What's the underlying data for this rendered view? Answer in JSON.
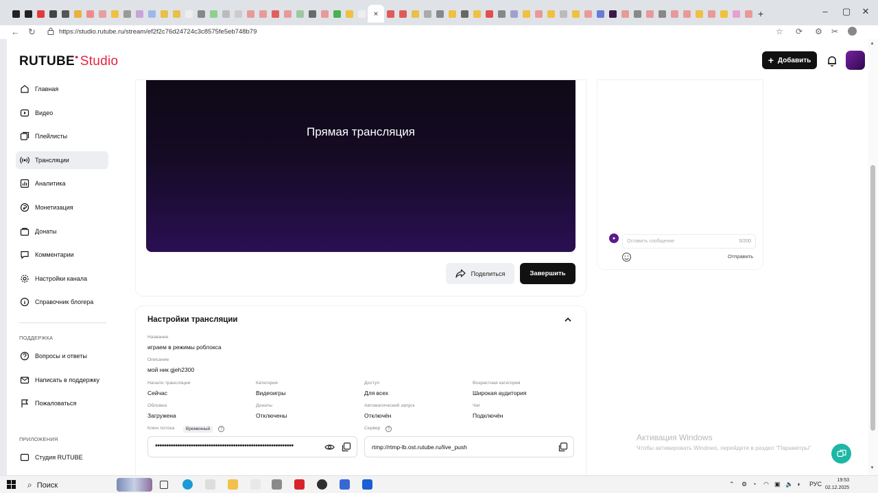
{
  "browser": {
    "url": "https://studio.rutube.ru/stream/ef2f2c76d24724c3c8575fe5eb748b79",
    "close_tab": "×",
    "new_tab": "+"
  },
  "header": {
    "logo_main": "RUTUBE",
    "logo_studio": "Studio",
    "add_button": "Добавить",
    "add_icon": "+"
  },
  "sidebar": {
    "items": [
      {
        "label": "Главная",
        "icon": "home-icon"
      },
      {
        "label": "Видео",
        "icon": "video-icon"
      },
      {
        "label": "Плейлисты",
        "icon": "playlist-icon"
      },
      {
        "label": "Трансляции",
        "icon": "broadcast-icon",
        "active": true
      },
      {
        "label": "Аналитика",
        "icon": "analytics-icon"
      },
      {
        "label": "Монетизация",
        "icon": "monetization-icon"
      },
      {
        "label": "Донаты",
        "icon": "donations-icon"
      },
      {
        "label": "Комментарии",
        "icon": "comments-icon"
      },
      {
        "label": "Настройки канала",
        "icon": "settings-icon"
      },
      {
        "label": "Справочник блогера",
        "icon": "info-icon"
      }
    ],
    "support_title": "ПОДДЕРЖКА",
    "support_items": [
      {
        "label": "Вопросы и ответы"
      },
      {
        "label": "Написать в поддержку"
      },
      {
        "label": "Пожаловаться"
      }
    ],
    "apps_title": "ПРИЛОЖЕНИЯ",
    "apps_items": [
      {
        "label": "Студия RUTUBE"
      }
    ]
  },
  "player": {
    "title": "Прямая трансляция",
    "share_button": "Поделиться",
    "end_button": "Завершить"
  },
  "chat": {
    "placeholder": "Оставить сообщение",
    "counter": "0/200",
    "send": "Отправить"
  },
  "settings": {
    "title": "Настройки трансляции",
    "name_label": "Название",
    "name_value": "играем в режимы роблокса",
    "desc_label": "Описание",
    "desc_value": "мой ник gjeh2300",
    "row1": [
      {
        "label": "Начало трансляции",
        "value": "Сейчас"
      },
      {
        "label": "Категория",
        "value": "Видеоигры"
      },
      {
        "label": "Доступ",
        "value": "Для всех"
      },
      {
        "label": "Возрастная категория",
        "value": "Широкая аудитория"
      }
    ],
    "row2": [
      {
        "label": "Обложка",
        "value": "Загружена"
      },
      {
        "label": "Донаты",
        "value": "Отключены"
      },
      {
        "label": "Автоматический запуск",
        "value": "Отключён"
      },
      {
        "label": "Чат",
        "value": "Подключён"
      }
    ],
    "key_label": "Ключ потока",
    "key_badge": "Временный",
    "key_value": "••••••••••••••••••••••••••••••••••••••••••••••••••••••••••••••",
    "server_label": "Сервер",
    "server_value": "rtmp://rtmp-lb.ost.rutube.ru/live_push"
  },
  "windows": {
    "activation_title": "Активация Windows",
    "activation_text": "Чтобы активировать Windows, перейдите в раздел \"Параметры\"",
    "search": "Поиск",
    "lang": "РУС",
    "time": "19:53",
    "date": "02.12.2025"
  },
  "colors": {
    "brand_red": "#e6213d",
    "player_bg_top": "#0e0916",
    "player_bg_bottom": "#2a0f52",
    "support_fab": "#1db7a6"
  }
}
